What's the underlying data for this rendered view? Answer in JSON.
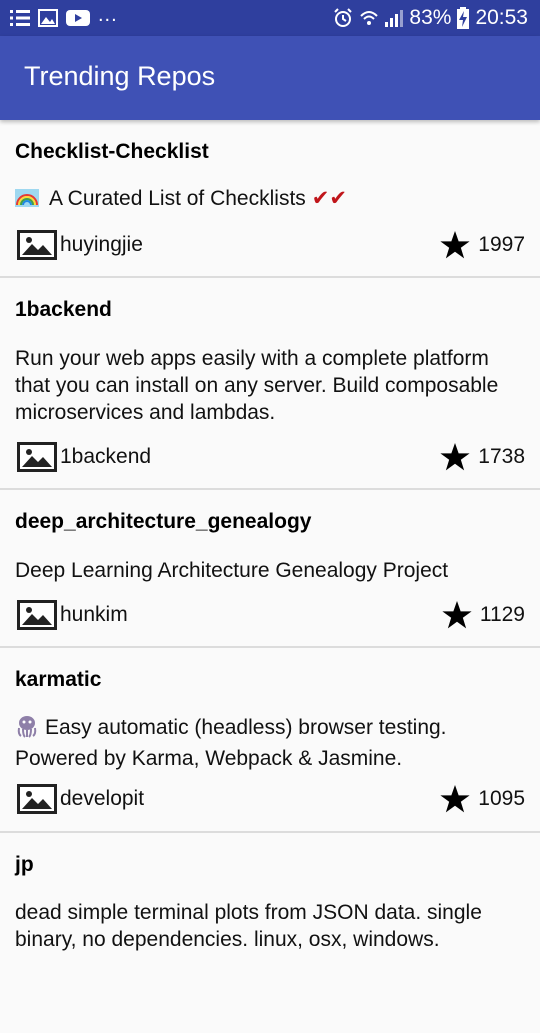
{
  "status_bar": {
    "dots": "...",
    "battery_percent": "83%",
    "time": "20:53",
    "icons_left": [
      "notification-list-icon",
      "gallery-icon",
      "youtube-icon"
    ],
    "icons_right": [
      "alarm-icon",
      "wifi-icon",
      "signal-icon",
      "battery-charging-icon"
    ]
  },
  "app_bar": {
    "title": "Trending Repos",
    "color": "#3f51b5"
  },
  "repos": [
    {
      "name": "Checklist-Checklist",
      "description": "A Curated List of Checklists",
      "desc_prefix_icon": "rainbow-emoji-icon",
      "desc_suffix": "✔✔",
      "owner": "huyingjie",
      "stars": "1997"
    },
    {
      "name": "1backend",
      "description": "Run your web apps easily with a complete platform that you can install on any server. Build composable microservices and lambdas.",
      "owner": "1backend",
      "stars": "1738"
    },
    {
      "name": "deep_architecture_genealogy",
      "description": "Deep Learning Architecture  Genealogy Project",
      "owner": "hunkim",
      "stars": "1129"
    },
    {
      "name": "karmatic",
      "description": "Easy automatic (headless) browser testing. Powered by Karma, Webpack & Jasmine.",
      "desc_prefix_icon": "octopus-emoji-icon",
      "owner": "developit",
      "stars": "1095"
    },
    {
      "name": "jp",
      "description": "dead simple terminal plots from JSON data. single binary, no dependencies. linux, osx, windows."
    }
  ]
}
